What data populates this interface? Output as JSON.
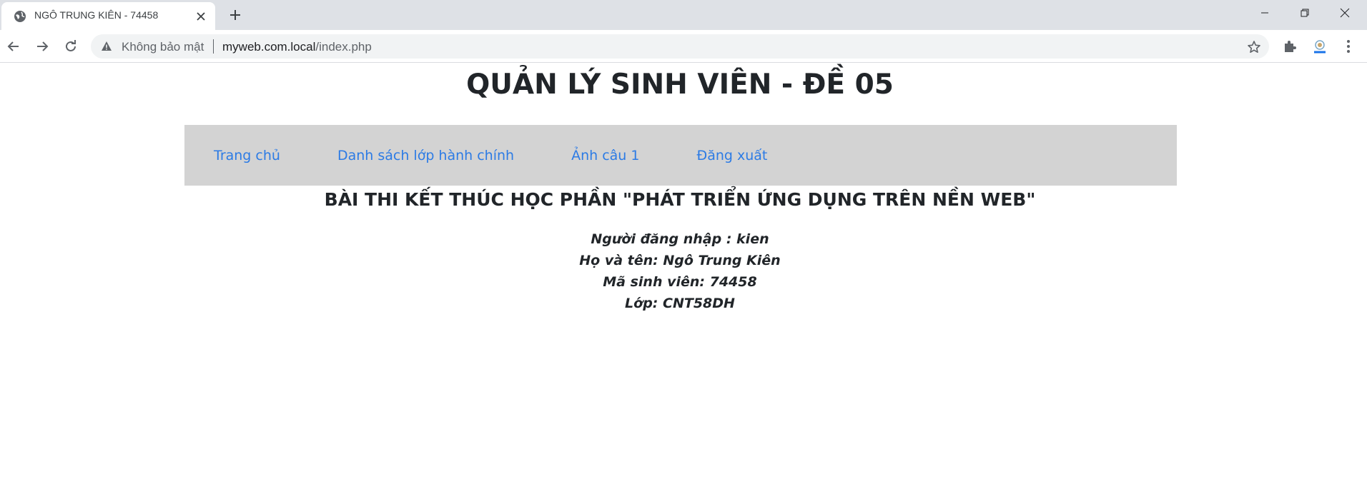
{
  "browser": {
    "tab": {
      "title": "NGÔ TRUNG KIÊN - 74458",
      "favicon": "globe-icon"
    },
    "address_bar": {
      "security_label": "Không bảo mật",
      "host": "myweb.com.local",
      "path": "/index.php"
    },
    "icons": {
      "back": "arrow-left-icon",
      "forward": "arrow-right-icon",
      "reload": "reload-icon",
      "bookmark": "star-icon",
      "extensions": "puzzle-icon",
      "profile": "profile-icon",
      "menu": "kebab-menu-icon"
    }
  },
  "page": {
    "title": "QUẢN LÝ SINH VIÊN - ĐỀ 05",
    "nav": [
      {
        "label": "Trang chủ"
      },
      {
        "label": "Danh sách lớp hành chính"
      },
      {
        "label": "Ảnh câu 1"
      },
      {
        "label": "Đăng xuất"
      }
    ],
    "exam_heading": "BÀI THI KẾT THÚC HỌC PHẦN \"PHÁT TRIỂN ỨNG DỤNG TRÊN NỀN WEB\"",
    "info": {
      "login_user": "Người đăng nhập : kien",
      "full_name": "Họ và tên: Ngô Trung Kiên",
      "student_id": "Mã sinh viên: 74458",
      "class": "Lớp: CNT58DH"
    }
  },
  "colors": {
    "nav_bg": "#d3d3d3",
    "link": "#2c7be5",
    "tabstrip": "#dee1e6"
  }
}
